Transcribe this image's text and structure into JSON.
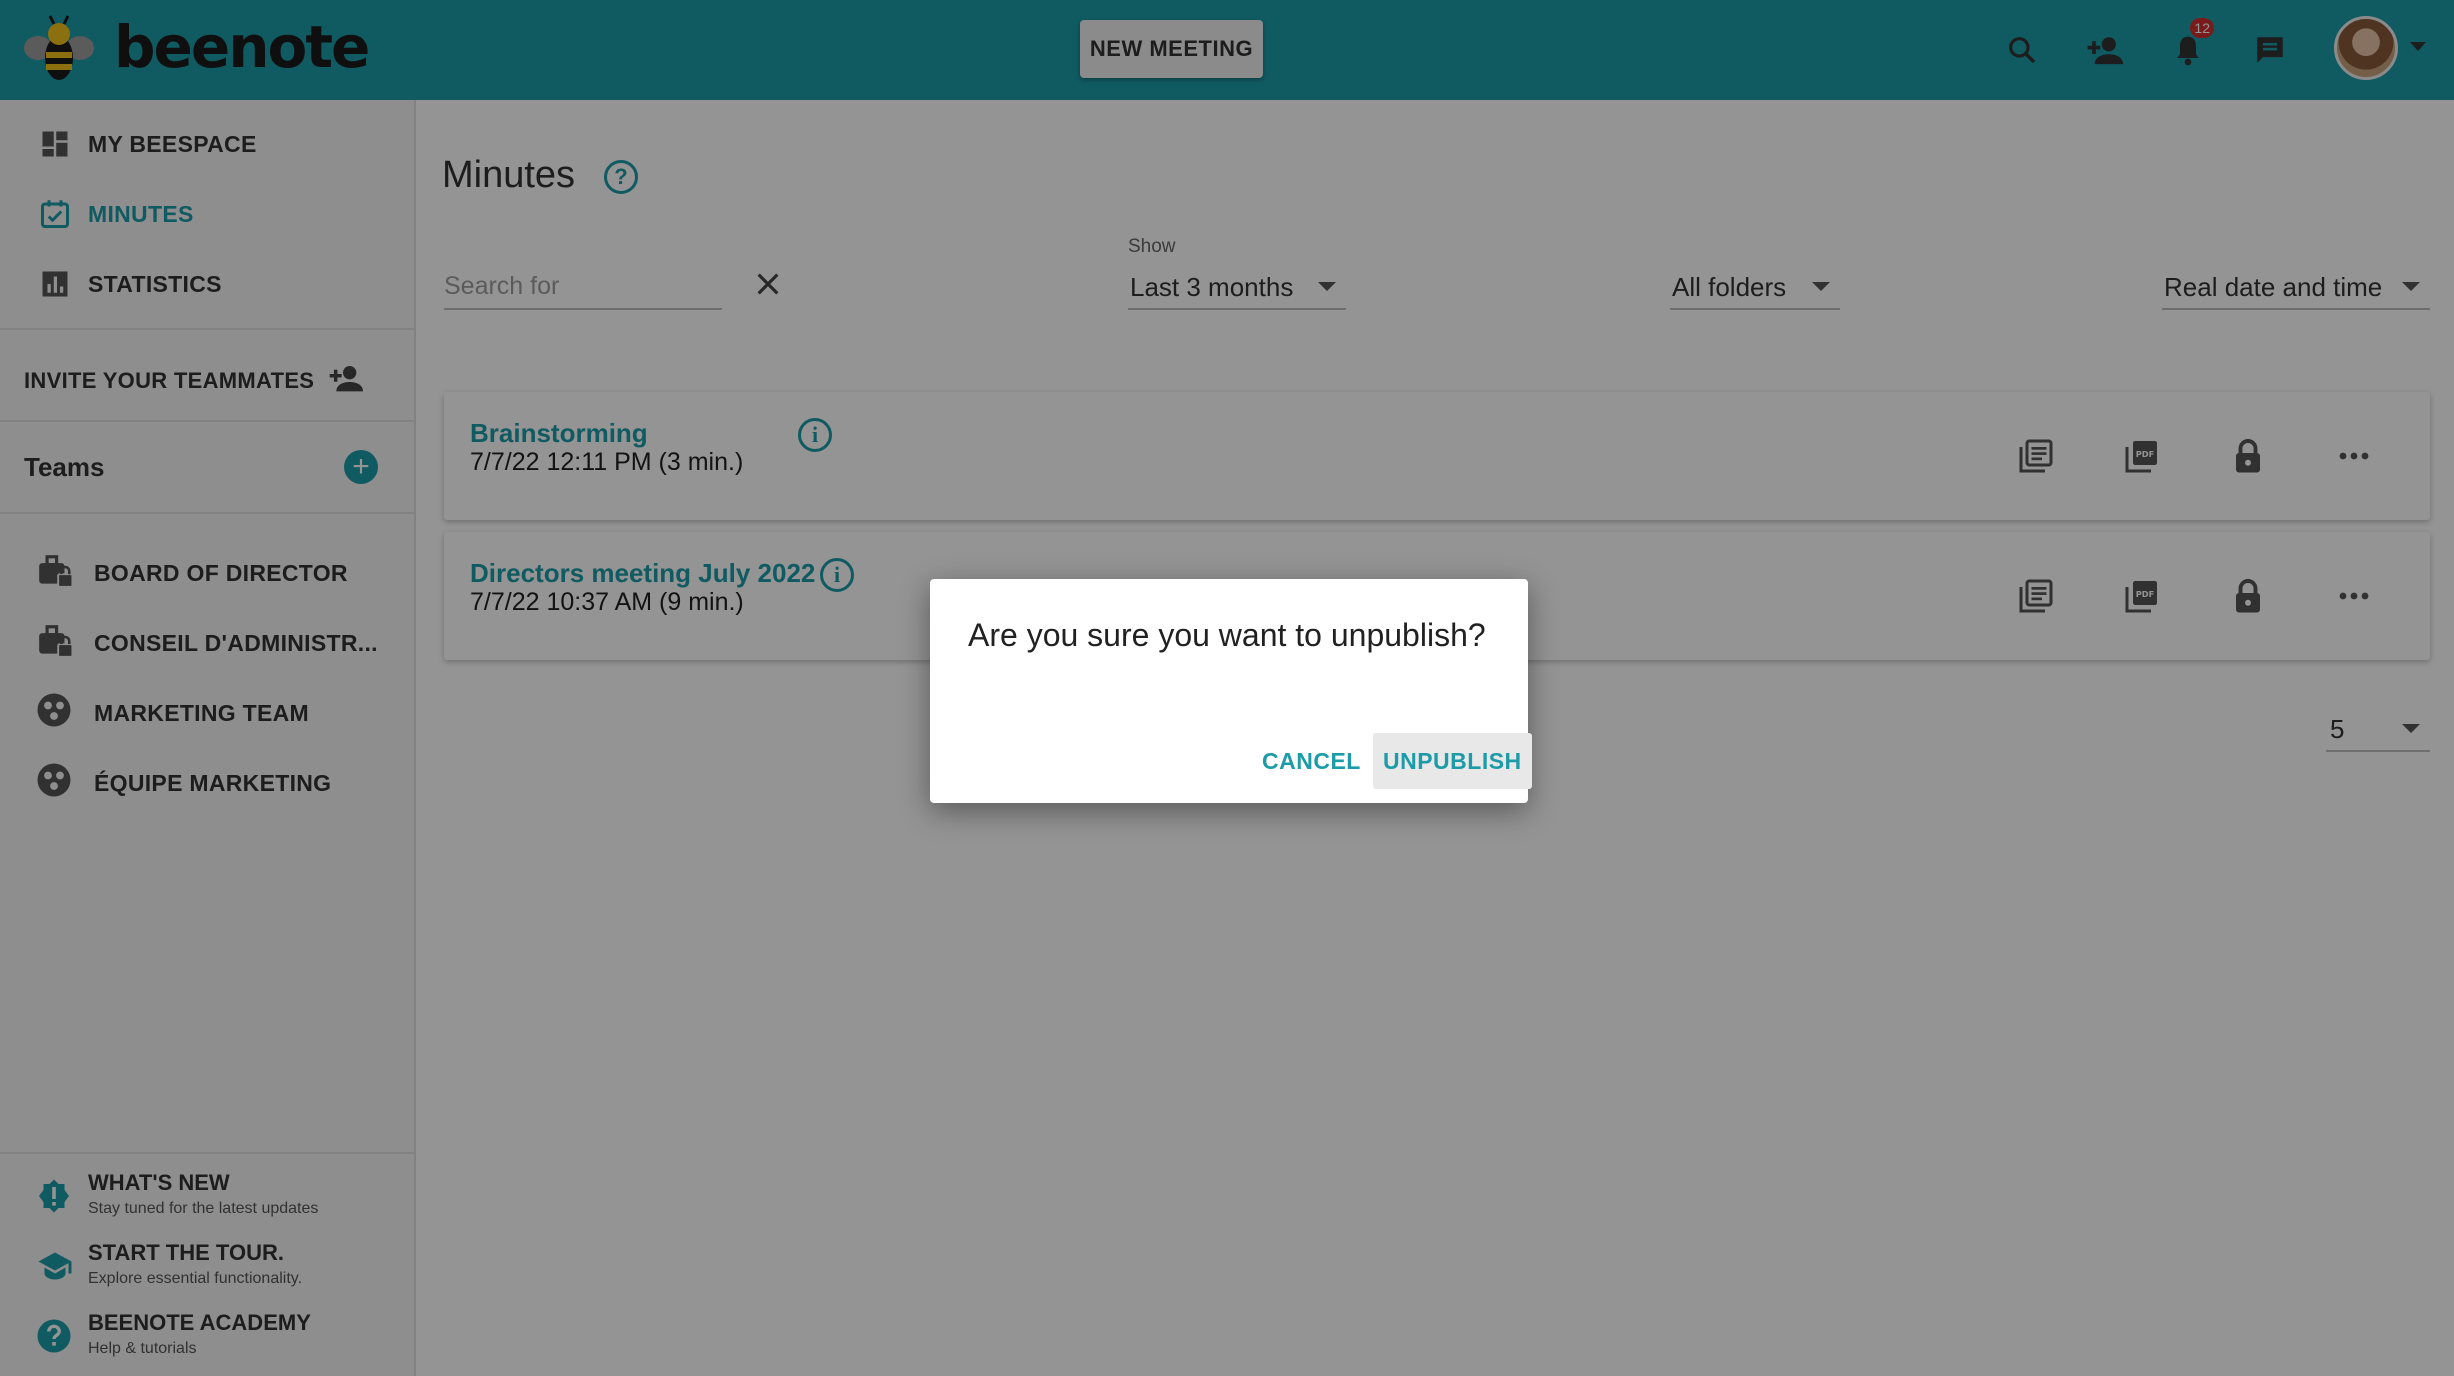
{
  "brand": {
    "name": "beenote",
    "accent": "#1c9ba8"
  },
  "header": {
    "new_meeting_label": "NEW MEETING",
    "notification_count": "12",
    "icons": [
      "search-icon",
      "add-user-icon",
      "bell-icon",
      "chat-icon",
      "avatar"
    ]
  },
  "sidebar": {
    "nav": [
      {
        "label": "MY BEESPACE",
        "icon": "dashboard-icon"
      },
      {
        "label": "MINUTES",
        "icon": "calendar-check-icon",
        "active": true
      },
      {
        "label": "STATISTICS",
        "icon": "bar-chart-icon"
      }
    ],
    "invite_label": "INVITE YOUR TEAMMATES",
    "teams_title": "Teams",
    "teams": [
      {
        "label": "BOARD OF DIRECTOR",
        "icon": "locked-briefcase-icon"
      },
      {
        "label": "CONSEIL D'ADMINISTR...",
        "icon": "locked-briefcase-icon"
      },
      {
        "label": "MARKETING TEAM",
        "icon": "team-icon"
      },
      {
        "label": "ÉQUIPE MARKETING",
        "icon": "team-icon"
      }
    ],
    "bottom": [
      {
        "label": "WHAT'S NEW",
        "sub": "Stay tuned for the latest updates",
        "icon": "new-badge-icon"
      },
      {
        "label": "START THE TOUR.",
        "sub": "Explore essential functionality.",
        "icon": "graduation-cap-icon"
      },
      {
        "label": "BEENOTE ACADEMY",
        "sub": "Help & tutorials",
        "icon": "help-circle-icon"
      }
    ]
  },
  "main": {
    "title": "Minutes",
    "search_placeholder": "Search for",
    "show_label": "Show",
    "show_value": "Last 3 months",
    "folders_value": "All folders",
    "date_mode_value": "Real date and time",
    "per_page": "5",
    "meetings": [
      {
        "title": "Brainstorming",
        "date": "7/7/22 12:11 PM (3 min.)"
      },
      {
        "title": "Directors meeting July 2022",
        "date": "7/7/22 10:37 AM (9 min.)"
      }
    ]
  },
  "dialog": {
    "message": "Are you sure you want to unpublish?",
    "cancel_label": "CANCEL",
    "confirm_label": "UNPUBLISH"
  }
}
